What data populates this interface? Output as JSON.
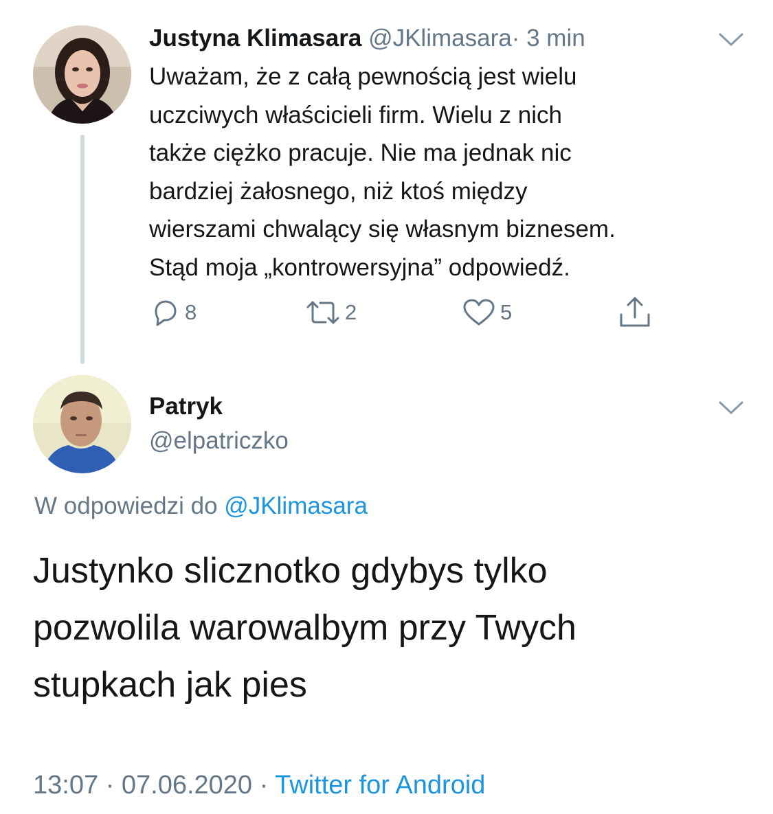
{
  "tweet_parent": {
    "author_name": "Justyna Klimasara",
    "author_handle": "@JKlimasara",
    "separator": "·",
    "time": "3 min",
    "text_lines": [
      "Uważam, że z całą pewnością jest wielu",
      "uczciwych właścicieli firm. Wielu z nich",
      "także ciężko pracuje. Nie ma jednak nic",
      "bardziej żałosnego, niż ktoś między",
      "wierszami chwalący się własnym biznesem.",
      "Stąd moja „kontrowersyjna” odpowiedź."
    ],
    "actions": {
      "reply_count": "8",
      "retweet_count": "2",
      "like_count": "5"
    }
  },
  "tweet_main": {
    "author_name": "Patryk",
    "author_handle": "@elpatriczko",
    "reply_prefix": "W odpowiedzi do",
    "reply_to_handle": "@JKlimasara",
    "text_lines": [
      "Justynko slicznotko gdybys tylko",
      "pozwolila warowalbym przy Twych",
      "stupkach jak pies"
    ],
    "footer": {
      "time": "13:07",
      "separator1": "·",
      "date": "07.06.2020",
      "separator2": "·",
      "source": "Twitter for Android"
    }
  },
  "icons": {
    "menu": "chevron-down-icon",
    "reply": "reply-icon",
    "retweet": "retweet-icon",
    "like": "heart-icon",
    "share": "share-icon"
  },
  "colors": {
    "text": "#14171a",
    "secondary": "#657786",
    "link": "#1b95e0",
    "thread_line": "#cfd9de"
  }
}
